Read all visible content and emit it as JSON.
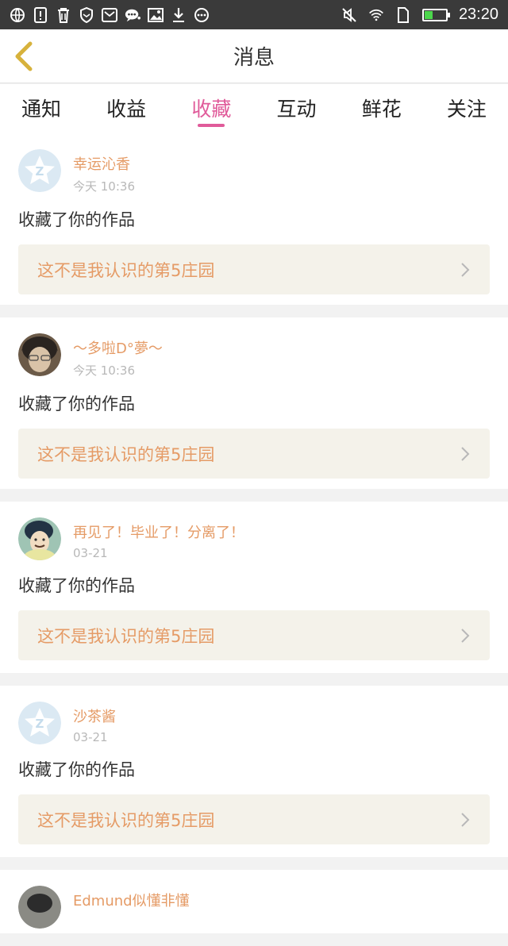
{
  "status_bar": {
    "time": "23:20",
    "left_icons": [
      "globe-icon",
      "alert-icon",
      "trash-icon",
      "shield-icon",
      "mail-icon",
      "chat-icon",
      "image-icon",
      "download-icon",
      "more-icon"
    ],
    "right_icons": [
      "mute-icon",
      "wifi-icon",
      "sim-icon",
      "battery-icon"
    ],
    "battery_level": 0.35
  },
  "navbar": {
    "title": "消息"
  },
  "tabs": [
    {
      "label": "通知"
    },
    {
      "label": "收益"
    },
    {
      "label": "收藏"
    },
    {
      "label": "互动"
    },
    {
      "label": "鲜花"
    },
    {
      "label": "关注"
    }
  ],
  "active_tab": "收藏",
  "items": [
    {
      "user": "幸运沁香",
      "time": "今天 10:36",
      "action": "收藏了你的作品",
      "work": "这不是我认识的第5庄园",
      "avatar": "default-avatar"
    },
    {
      "user": "～多啦D°夢～",
      "time": "今天 10:36",
      "action": "收藏了你的作品",
      "work": "这不是我认识的第5庄园",
      "avatar": "girl-avatar"
    },
    {
      "user": "再见了！毕业了！分离了！",
      "time": "03-21",
      "action": "收藏了你的作品",
      "work": "这不是我认识的第5庄园",
      "avatar": "boy-avatar"
    },
    {
      "user": "沙茶酱",
      "time": "03-21",
      "action": "收藏了你的作品",
      "work": "这不是我认识的第5庄园",
      "avatar": "default-avatar"
    },
    {
      "user": "Edmund似懂非懂",
      "avatar": "photo-avatar"
    }
  ],
  "colors": {
    "accent": "#e05b9a",
    "username": "#e59b66",
    "card_bg": "#f4f2ea"
  }
}
